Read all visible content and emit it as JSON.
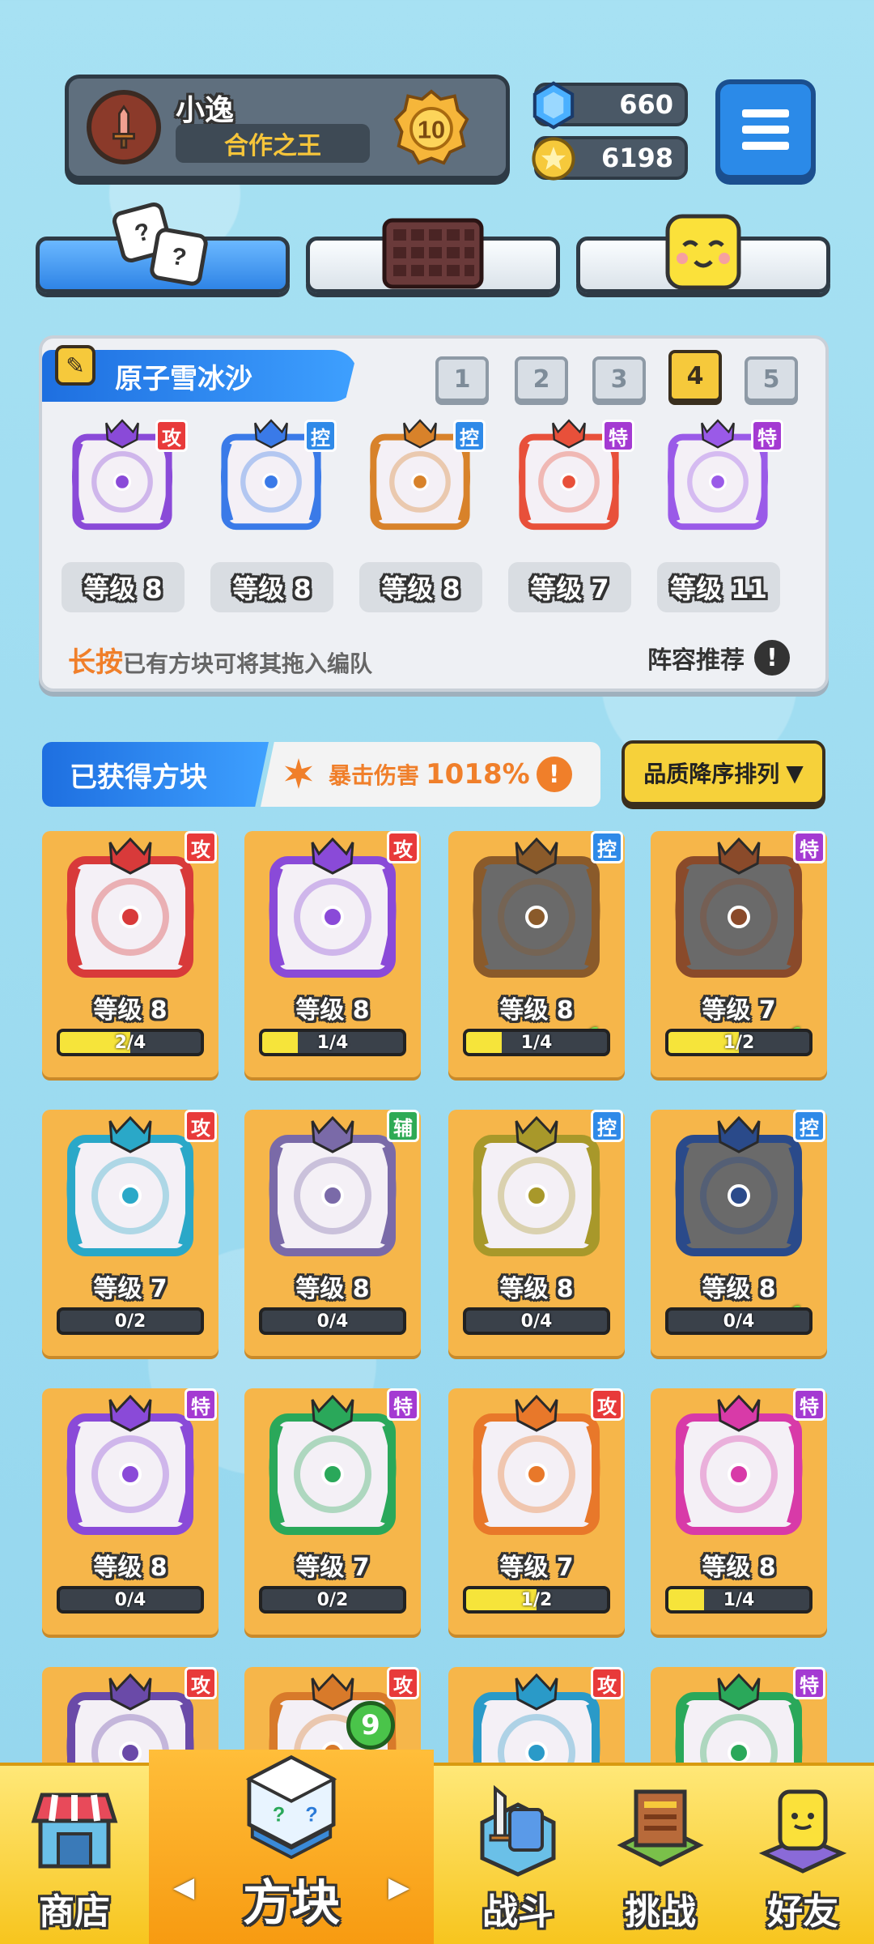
{
  "profile": {
    "name": "小逸",
    "title": "合作之王",
    "rank": "10"
  },
  "currency": {
    "gems": "660",
    "coins": "6198"
  },
  "tabs": [
    "dice-tab",
    "board-tab",
    "emoji-tab"
  ],
  "deck": {
    "title": "原子雪冰沙",
    "deck_tabs": [
      "1",
      "2",
      "3",
      "4",
      "5"
    ],
    "active_tab": 3,
    "slots": [
      {
        "type": "攻",
        "level": "等级 8",
        "color": "#8a4ad8"
      },
      {
        "type": "控",
        "level": "等级 8",
        "color": "#3a7ae8"
      },
      {
        "type": "控",
        "level": "等级 8",
        "color": "#d8822a"
      },
      {
        "type": "特",
        "level": "等级 7",
        "color": "#e8503a"
      },
      {
        "type": "特",
        "level": "等级 11",
        "color": "#9a5ae8"
      }
    ],
    "hint_bold": "长按",
    "hint_rest": "已有方块可将其拖入编队",
    "recommend": "阵容推荐",
    "info_mark": "!"
  },
  "collection": {
    "title": "已获得方块",
    "crit_label": "暴击伤害",
    "crit_value": "1018%",
    "sort_label": "品质降序排列",
    "sort_arrow": "▼",
    "cards": [
      {
        "type": "攻",
        "level": "等级 8",
        "progress": "2/4",
        "fill": 0.5,
        "color": "#d83a3a",
        "equipped": false
      },
      {
        "type": "攻",
        "level": "等级 8",
        "progress": "1/4",
        "fill": 0.25,
        "color": "#8a4ad8",
        "equipped": false
      },
      {
        "type": "控",
        "level": "等级 8",
        "progress": "1/4",
        "fill": 0.25,
        "color": "#8a5a2a",
        "equipped": true
      },
      {
        "type": "特",
        "level": "等级 7",
        "progress": "1/2",
        "fill": 0.5,
        "color": "#8a4a2a",
        "equipped": true
      },
      {
        "type": "攻",
        "level": "等级 7",
        "progress": "0/2",
        "fill": 0,
        "color": "#2aa8c8",
        "equipped": false
      },
      {
        "type": "辅",
        "level": "等级 8",
        "progress": "0/4",
        "fill": 0,
        "color": "#7a6aa8",
        "equipped": false
      },
      {
        "type": "控",
        "level": "等级 8",
        "progress": "0/4",
        "fill": 0,
        "color": "#a8982a",
        "equipped": false
      },
      {
        "type": "控",
        "level": "等级 8",
        "progress": "0/4",
        "fill": 0,
        "color": "#2a4a8a",
        "equipped": true
      },
      {
        "type": "特",
        "level": "等级 8",
        "progress": "0/4",
        "fill": 0,
        "color": "#8a4ad8",
        "equipped": false
      },
      {
        "type": "特",
        "level": "等级 7",
        "progress": "0/2",
        "fill": 0,
        "color": "#2aa85a",
        "equipped": false
      },
      {
        "type": "攻",
        "level": "等级 7",
        "progress": "1/2",
        "fill": 0.5,
        "color": "#e8782a",
        "equipped": false
      },
      {
        "type": "特",
        "level": "等级 8",
        "progress": "1/4",
        "fill": 0.25,
        "color": "#d83aa8",
        "equipped": false
      },
      {
        "type": "攻",
        "level": "",
        "progress": "",
        "fill": 0,
        "color": "#6a4aa8",
        "equipped": false
      },
      {
        "type": "攻",
        "level": "",
        "progress": "",
        "fill": 0,
        "color": "#d87a2a",
        "equipped": false
      },
      {
        "type": "攻",
        "level": "",
        "progress": "",
        "fill": 0,
        "color": "#2a9ac8",
        "equipped": false
      },
      {
        "type": "特",
        "level": "",
        "progress": "",
        "fill": 0,
        "color": "#2aa85a",
        "equipped": false
      }
    ]
  },
  "nav": {
    "shop": "商店",
    "blocks": "方块",
    "blocks_count": "9",
    "battle": "战斗",
    "challenge": "挑战",
    "friends": "好友",
    "left_arrow": "◀",
    "right_arrow": "▶"
  }
}
